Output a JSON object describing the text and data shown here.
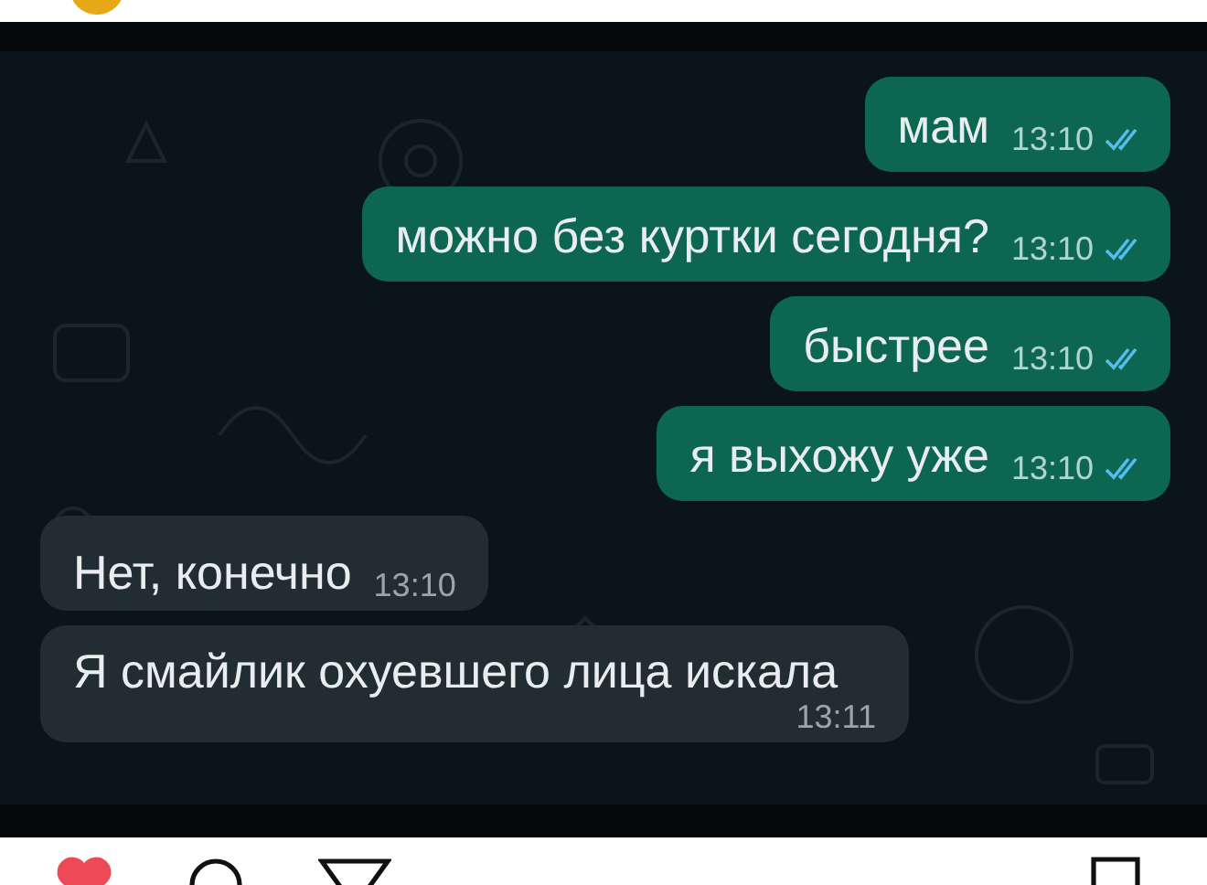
{
  "messages": [
    {
      "kind": "sent",
      "text": "мам",
      "time": "13:10",
      "read": true
    },
    {
      "kind": "sent",
      "text": "можно без куртки сегодня?",
      "time": "13:10",
      "read": true
    },
    {
      "kind": "sent",
      "text": "быстрее",
      "time": "13:10",
      "read": true
    },
    {
      "kind": "sent",
      "text": "я выхожу уже",
      "time": "13:10",
      "read": true
    },
    {
      "kind": "received",
      "text": "Нет, конечно",
      "time": "13:10"
    },
    {
      "kind": "received",
      "text": "Я смайлик охуевшего лица искала",
      "time": "13:11"
    }
  ]
}
